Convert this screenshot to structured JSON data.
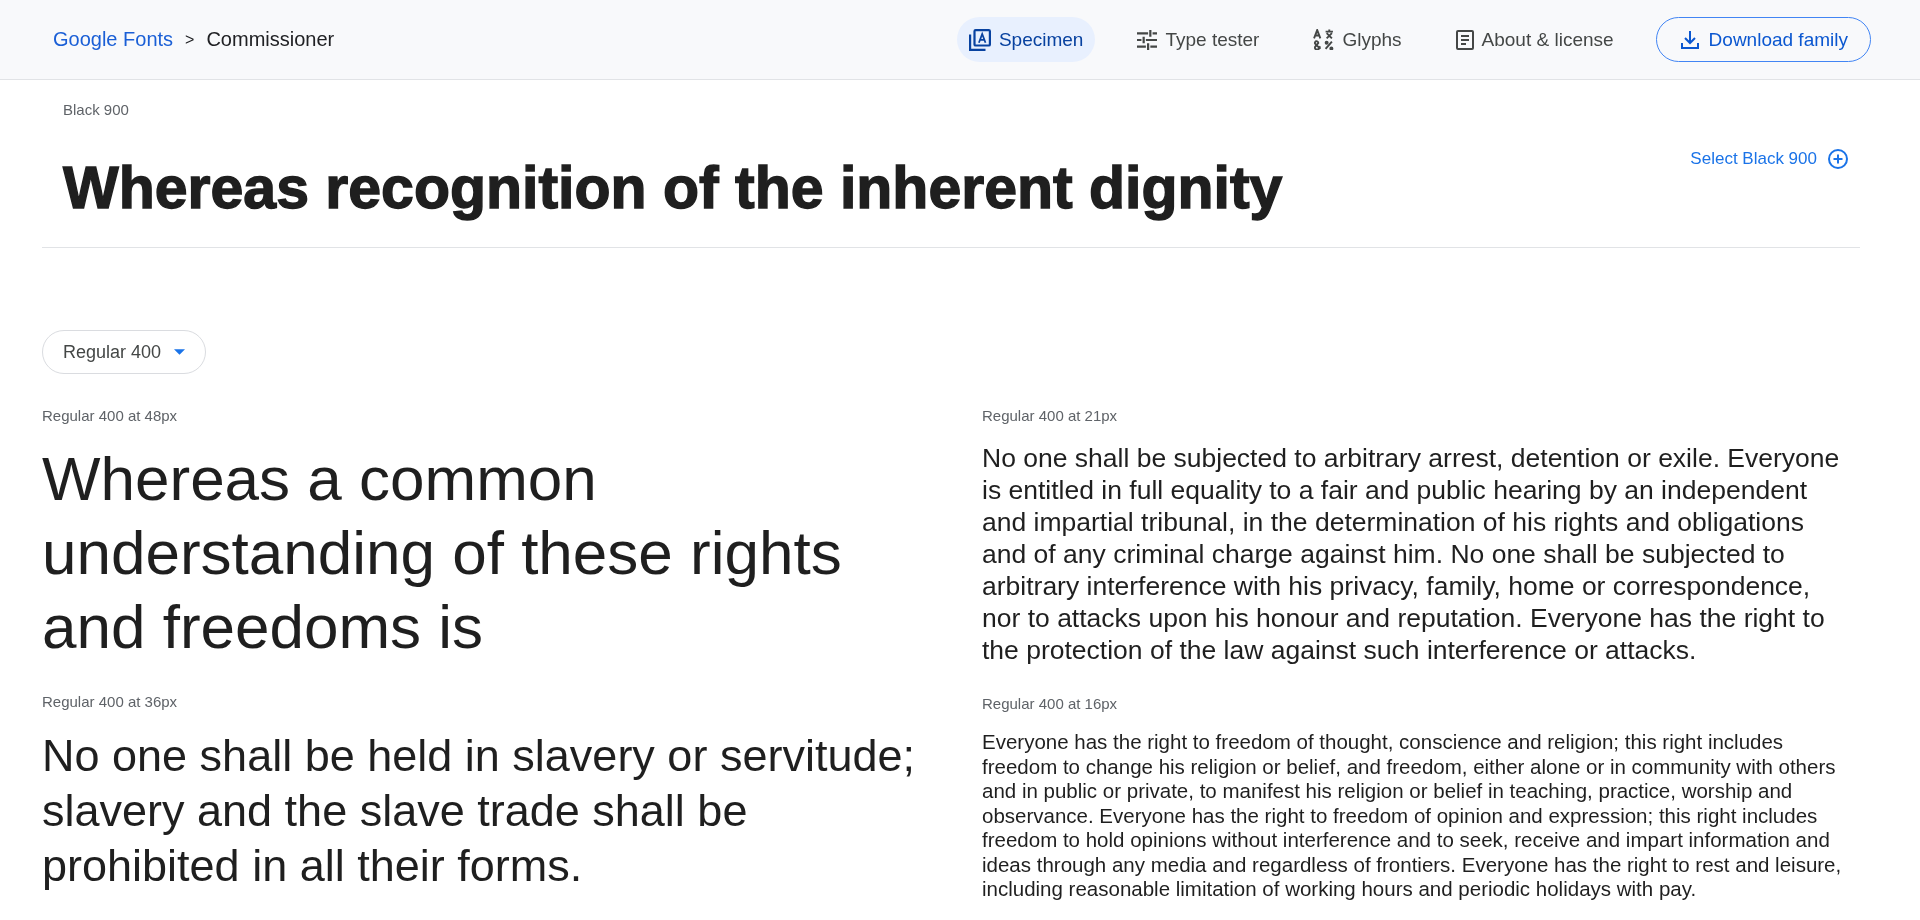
{
  "breadcrumb": {
    "link": "Google Fonts",
    "separator": ">",
    "current": "Commissioner"
  },
  "tabs": [
    {
      "label": "Specimen",
      "selected": true
    },
    {
      "label": "Type tester",
      "selected": false
    },
    {
      "label": "Glyphs",
      "selected": false
    },
    {
      "label": "About & license",
      "selected": false
    }
  ],
  "download_button": {
    "label": "Download family"
  },
  "weight_preview": {
    "style": "Black 900",
    "sample": "Whereas recognition of the inherent dignity",
    "select_button": "Select Black 900"
  },
  "style_dropdown": {
    "value": "Regular 400"
  },
  "columns": [
    {
      "samples": [
        {
          "kind": "display",
          "label": "Regular 400 at 48px",
          "text": "Whereas a common understanding of these rights and freedoms is"
        },
        {
          "kind": "headline",
          "label": "Regular 400 at 36px",
          "text": "No one shall be held in slavery or servitude; slavery and the slave trade shall be prohibited in all their forms."
        }
      ]
    },
    {
      "samples": [
        {
          "kind": "lead",
          "label": "Regular 400 at 21px",
          "text": "No one shall be subjected to arbitrary arrest, detention or exile. Everyone is entitled in full equality to a fair and public hearing by an independent and impartial tribunal, in the determination of his rights and obligations and of any criminal charge against him. No one shall be subjected to arbitrary interference with his privacy, family, home or correspondence, nor to attacks upon his honour and reputation. Everyone has the right to the protection of the law against such interference or attacks."
        },
        {
          "kind": "body",
          "label": "Regular 400 at 16px",
          "text": "Everyone has the right to freedom of thought, conscience and religion; this right includes freedom to change his religion or belief, and freedom, either alone or in community with others and in public or private, to manifest his religion or belief in teaching, practice, worship and observance. Everyone has the right to freedom of opinion and expression; this right includes freedom to hold opinions without interference and to seek, receive and impart information and ideas through any media and regardless of frontiers. Everyone has the right to rest and leisure, including reasonable limitation of working hours and periodic holidays with pay."
        }
      ]
    }
  ]
}
